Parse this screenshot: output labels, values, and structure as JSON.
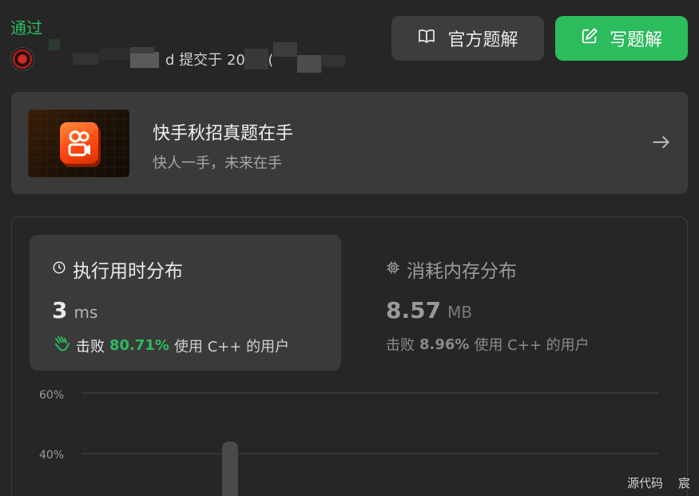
{
  "submission": {
    "status": "通过",
    "submitted_text": "d 提交于 2024.("
  },
  "buttons": {
    "official_solution": "官方题解",
    "write_solution": "写题解"
  },
  "banner": {
    "title": "快手秋招真题在手",
    "subtitle": "快人一手，未来在手"
  },
  "runtime": {
    "title": "执行用时分布",
    "value": "3",
    "unit": "ms",
    "beats_label": "击败",
    "beats_pct": "80.71%",
    "suffix": "使用 C++ 的用户"
  },
  "memory": {
    "title": "消耗内存分布",
    "value": "8.57",
    "unit": "MB",
    "beats_label": "击败",
    "beats_pct": "8.96%",
    "suffix": "使用 C++ 的用户"
  },
  "chart_data": {
    "type": "bar",
    "y_ticks": [
      "60%",
      "40%"
    ],
    "ylim": [
      0,
      60
    ],
    "values": [
      44
    ],
    "grid": true
  },
  "footer": {
    "source_code": "源代码",
    "extra": "宸"
  },
  "colors": {
    "accent_green": "#2cbb5d",
    "background": "#262626"
  }
}
